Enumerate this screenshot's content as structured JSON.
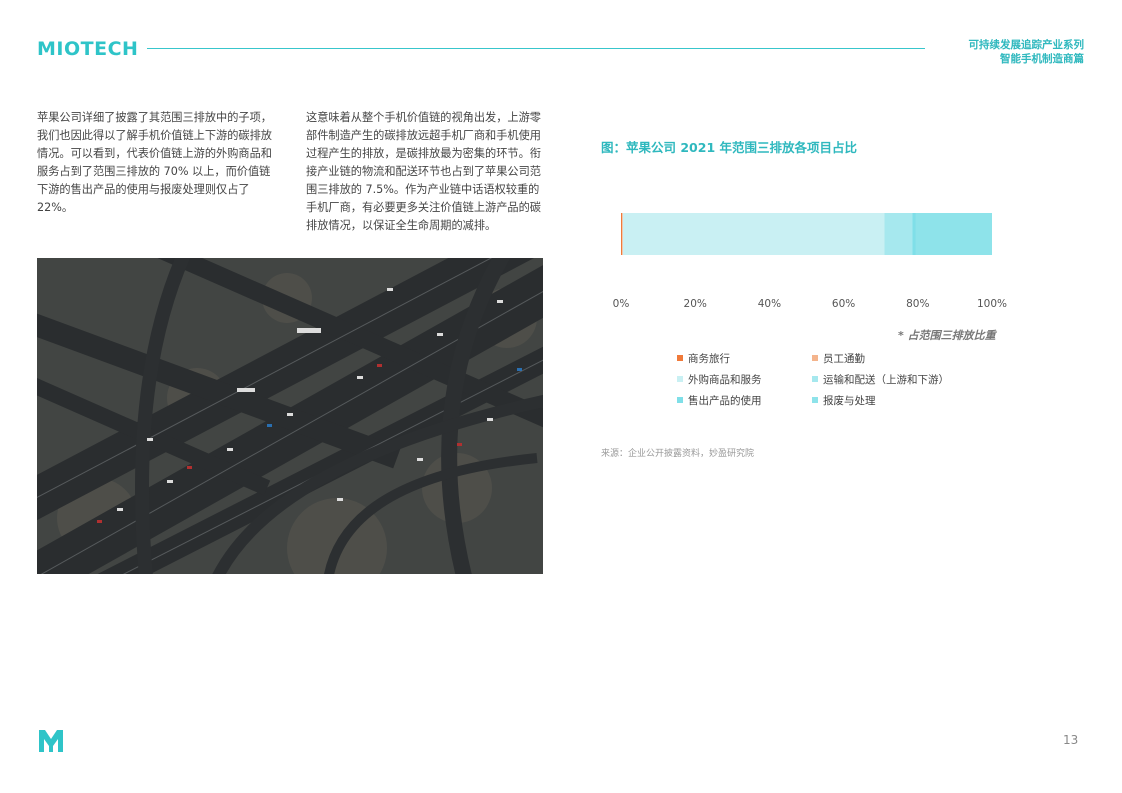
{
  "header": {
    "brand": "MIOTECH",
    "series_line1": "可持续发展追踪产业系列",
    "series_line2": "智能手机制造商篇"
  },
  "body": {
    "paragraph1": "苹果公司详细了披露了其范围三排放中的子项，我们也因此得以了解手机价值链上下游的碳排放情况。可以看到，代表价值链上游的外购商品和服务占到了范围三排放的 70% 以上，而价值链下游的售出产品的使用与报废处理则仅占了 22%。",
    "paragraph2": "这意味着从整个手机价值链的视角出发，上游零部件制造产生的碳排放远超手机厂商和手机使用过程产生的排放，是碳排放最为密集的环节。衔接产业链的物流和配送环节也占到了苹果公司范围三排放的 7.5%。作为产业链中话语权较重的手机厂商，有必要更多关注价值链上游产品的碳排放情况，以保证全生命周期的减排。"
  },
  "figure": {
    "title": "图：苹果公司 2021 年范围三排放各项目占比",
    "note": "* 占范围三排放比重",
    "source": "来源：企业公开披露资料，妙盈研究院"
  },
  "chart_data": {
    "type": "bar",
    "orientation": "horizontal",
    "stacked": true,
    "title": "图：苹果公司 2021 年范围三排放各项目占比",
    "x_ticks": [
      "0%",
      "20%",
      "40%",
      "60%",
      "80%",
      "100%"
    ],
    "xlim": [
      0,
      100
    ],
    "series": [
      {
        "name": "商务旅行",
        "value": 0.3,
        "color": "#f07a3a"
      },
      {
        "name": "员工通勤",
        "value": 0.2,
        "color": "#f4b48c"
      },
      {
        "name": "外购商品和服务",
        "value": 70.5,
        "color": "#c9f0f3"
      },
      {
        "name": "运输和配送（上游和下游）",
        "value": 7.5,
        "color": "#a6e8ee"
      },
      {
        "name": "售出产品的使用",
        "value": 1.0,
        "color": "#7fdfe8"
      },
      {
        "name": "报废与处理",
        "value": 20.5,
        "color": "#8ee3ea"
      }
    ],
    "legend_placement": "bottom",
    "grid": false
  },
  "page": {
    "number": "13"
  }
}
